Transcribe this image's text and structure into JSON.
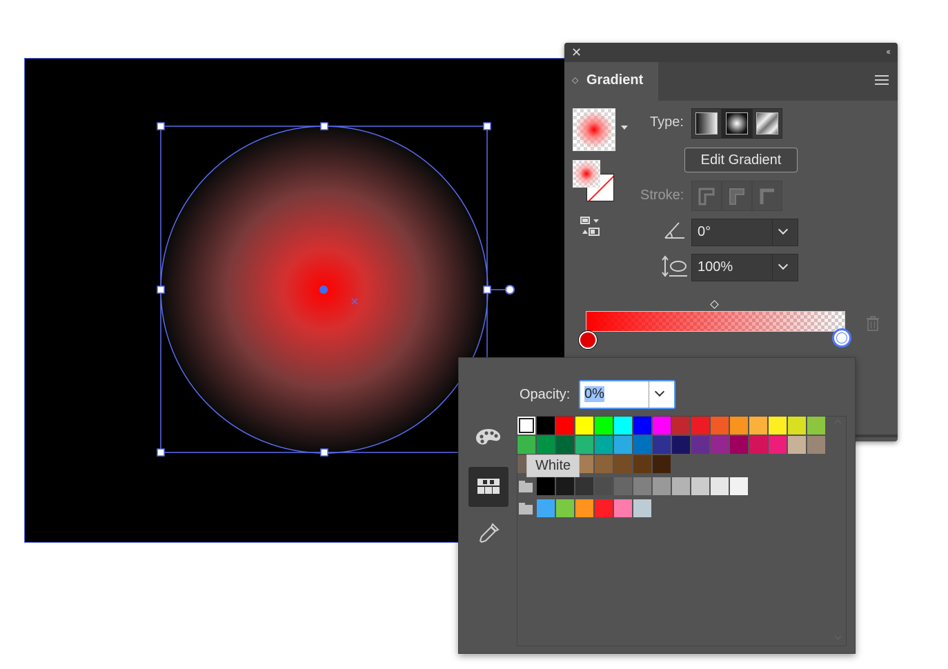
{
  "colors": {
    "panel_bg": "#535353",
    "selection_blue": "#4f6bf0",
    "gradient_start": "#ff0000",
    "accent_focus": "#4f9cff"
  },
  "gradient_panel": {
    "close_icon": "close-icon",
    "collapse_icon": "double-chevron-left-icon",
    "title": "Gradient",
    "menu_icon": "hamburger-menu-icon",
    "type_label": "Type:",
    "type_buttons": [
      "linear-gradient-icon",
      "radial-gradient-icon",
      "freeform-gradient-icon"
    ],
    "selected_type": "radial",
    "edit_button": "Edit Gradient",
    "stroke_label": "Stroke:",
    "stroke_buttons": [
      "stroke-within-icon",
      "stroke-along-icon",
      "stroke-across-icon"
    ],
    "angle_icon": "angle-icon",
    "angle_value": "0°",
    "aspect_icon": "aspect-ratio-icon",
    "aspect_value": "100%",
    "trash_icon": "trash-icon"
  },
  "swatch_popup": {
    "side_icons": [
      "palette-icon",
      "swatches-grid-icon",
      "eyedropper-icon"
    ],
    "active_side": "swatches",
    "opacity_label": "Opacity:",
    "opacity_value": "0%",
    "tooltip": "White",
    "rows": [
      [
        "#ffffff",
        "#000000",
        "#ff0000",
        "#ffff00",
        "#00ff00",
        "#00ffff",
        "#0000ff",
        "#ff00ff",
        "#c1272d",
        "#ed1c24",
        "#f15a24",
        "#f7931e",
        "#fbb03b",
        "#fcee21",
        "#d9e021",
        "#8cc63f"
      ],
      [
        "#39b54a",
        "#009245",
        "#006837",
        "#22b573",
        "#00a99d",
        "#29abe2",
        "#0071bc",
        "#2e3192",
        "#1b1464",
        "#662d91",
        "#93278f",
        "#9e005d",
        "#d4145a",
        "#ed1e79",
        "#c7b299",
        "#998675"
      ],
      [
        "#736357",
        "#534741",
        "#c69c6d",
        "#a67c52",
        "#8c6239",
        "#754c24",
        "#603813",
        "#42210b"
      ],
      [
        "#000000",
        "#1a1a1a",
        "#333333",
        "#4d4d4d",
        "#666666",
        "#808080",
        "#999999",
        "#b3b3b3",
        "#cccccc",
        "#e6e6e6",
        "#f2f2f2"
      ],
      [
        "#3fa9f5",
        "#7ac943",
        "#ff931e",
        "#ff1d25",
        "#ff7bac",
        "#bdccd4"
      ]
    ]
  }
}
